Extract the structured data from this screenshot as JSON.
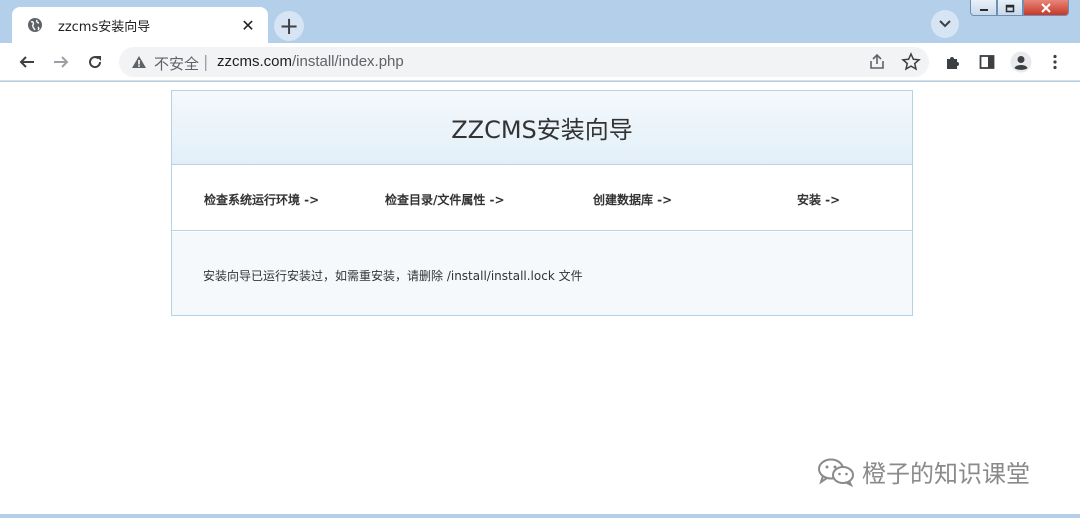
{
  "browser": {
    "tab": {
      "title": "zzcms安装向导",
      "close_symbol": "✕"
    },
    "new_tab_symbol": "+",
    "address": {
      "security_label": "不安全",
      "separator": "|",
      "host": "zzcms.com",
      "path": "/install/index.php"
    },
    "icons": {
      "back": "back-arrow-icon",
      "forward": "forward-arrow-icon",
      "reload": "reload-icon",
      "warning": "warning-icon",
      "share": "share-icon",
      "bookmark": "star-icon",
      "extensions": "puzzle-icon",
      "sidepanel": "side-panel-icon",
      "profile": "profile-icon",
      "menu": "kebab-menu-icon"
    }
  },
  "installer": {
    "title": "ZZCMS安装向导",
    "steps": [
      {
        "label": "检查系统运行环境 ->"
      },
      {
        "label": "检查目录/文件属性 ->"
      },
      {
        "label": "创建数据库 ->"
      },
      {
        "label": "安装 ->"
      }
    ],
    "message": "安装向导已运行安装过，如需重安装，请删除 /install/install.lock 文件"
  },
  "watermark": {
    "text": "橙子的知识课堂"
  },
  "colors": {
    "frame": "#b3cfe9",
    "panel_border": "#b6d3e5",
    "header_gradient_top": "#f4f9fc",
    "header_gradient_bottom": "#e2eff8",
    "body_bg": "#f5f9fc",
    "close_button": "#c7392a"
  }
}
